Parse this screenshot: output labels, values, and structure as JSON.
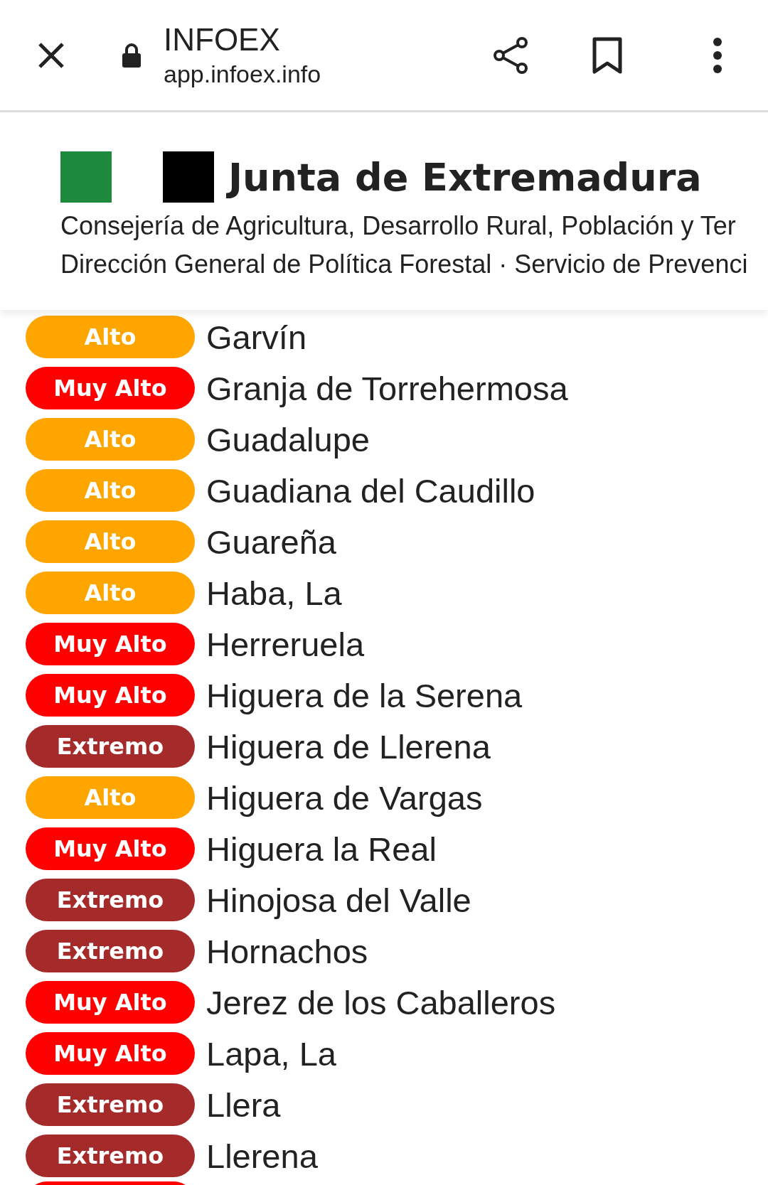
{
  "browser_bar": {
    "title": "INFOEX",
    "url": "app.infoex.info"
  },
  "header": {
    "title": "Junta de Extremadura",
    "lines": [
      "Consejería de Agricultura, Desarrollo Rural, Población y Ter",
      "Dirección General de Política Forestal · Servicio de Prevenci"
    ]
  },
  "rows": [
    {
      "risk": "Alto",
      "color": "#ffa500",
      "name": "Garvín"
    },
    {
      "risk": "Muy Alto",
      "color": "#ff0000",
      "name": "Granja de Torrehermosa"
    },
    {
      "risk": "Alto",
      "color": "#ffa500",
      "name": "Guadalupe"
    },
    {
      "risk": "Alto",
      "color": "#ffa500",
      "name": "Guadiana del Caudillo"
    },
    {
      "risk": "Alto",
      "color": "#ffa500",
      "name": "Guareña"
    },
    {
      "risk": "Alto",
      "color": "#ffa500",
      "name": "Haba, La"
    },
    {
      "risk": "Muy Alto",
      "color": "#ff0000",
      "name": "Herreruela"
    },
    {
      "risk": "Muy Alto",
      "color": "#ff0000",
      "name": "Higuera de la Serena"
    },
    {
      "risk": "Extremo",
      "color": "#a52a2a",
      "name": "Higuera de Llerena"
    },
    {
      "risk": "Alto",
      "color": "#ffa500",
      "name": "Higuera de Vargas"
    },
    {
      "risk": "Muy Alto",
      "color": "#ff0000",
      "name": "Higuera la Real"
    },
    {
      "risk": "Extremo",
      "color": "#a52a2a",
      "name": "Hinojosa del Valle"
    },
    {
      "risk": "Extremo",
      "color": "#a52a2a",
      "name": "Hornachos"
    },
    {
      "risk": "Muy Alto",
      "color": "#ff0000",
      "name": "Jerez de los Caballeros"
    },
    {
      "risk": "Muy Alto",
      "color": "#ff0000",
      "name": "Lapa, La"
    },
    {
      "risk": "Extremo",
      "color": "#a52a2a",
      "name": "Llera"
    },
    {
      "risk": "Extremo",
      "color": "#a52a2a",
      "name": "Llerena"
    }
  ]
}
